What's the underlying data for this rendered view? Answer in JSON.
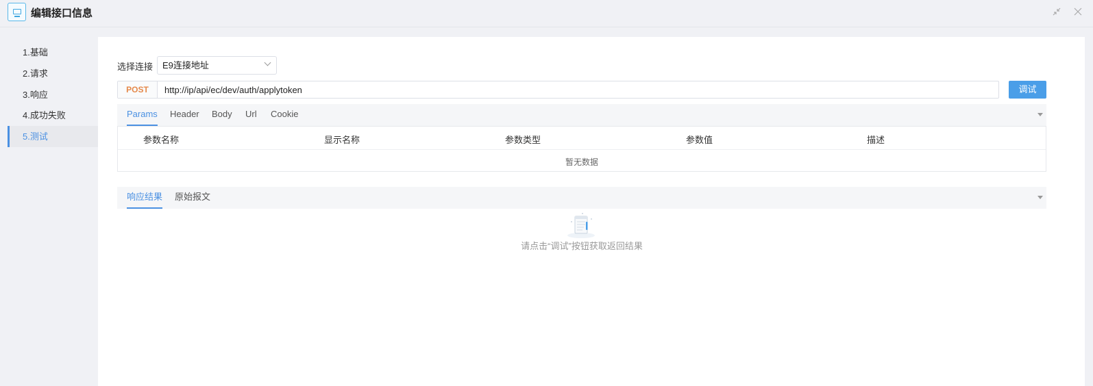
{
  "window": {
    "title": "编辑接口信息",
    "icons": {
      "app": "monitor-icon",
      "shrink": "shrink-icon",
      "close": "close-icon"
    }
  },
  "sidebar": {
    "items": [
      {
        "label": "1.基础"
      },
      {
        "label": "2.请求"
      },
      {
        "label": "3.响应"
      },
      {
        "label": "4.成功失败"
      },
      {
        "label": "5.测试",
        "active": true
      }
    ]
  },
  "connection": {
    "label": "选择连接",
    "selected": "E9连接地址"
  },
  "request": {
    "method": "POST",
    "url": "http://ip/api/ec/dev/auth/applytoken",
    "debug_label": "调试"
  },
  "params_tabs": {
    "tabs": [
      "Params",
      "Header",
      "Body",
      "Url",
      "Cookie"
    ],
    "active": "Params"
  },
  "params_table": {
    "columns": [
      "参数名称",
      "显示名称",
      "参数类型",
      "参数值",
      "描述"
    ],
    "empty_text": "暂无数据"
  },
  "response_tabs": {
    "tabs": [
      "响应结果",
      "原始报文"
    ],
    "active": "响应结果"
  },
  "response": {
    "hint": "请点击“调试”按钮获取返回结果"
  },
  "colors": {
    "accent": "#4a90e2",
    "button": "#4a9ee8",
    "method": "#e5894b"
  }
}
